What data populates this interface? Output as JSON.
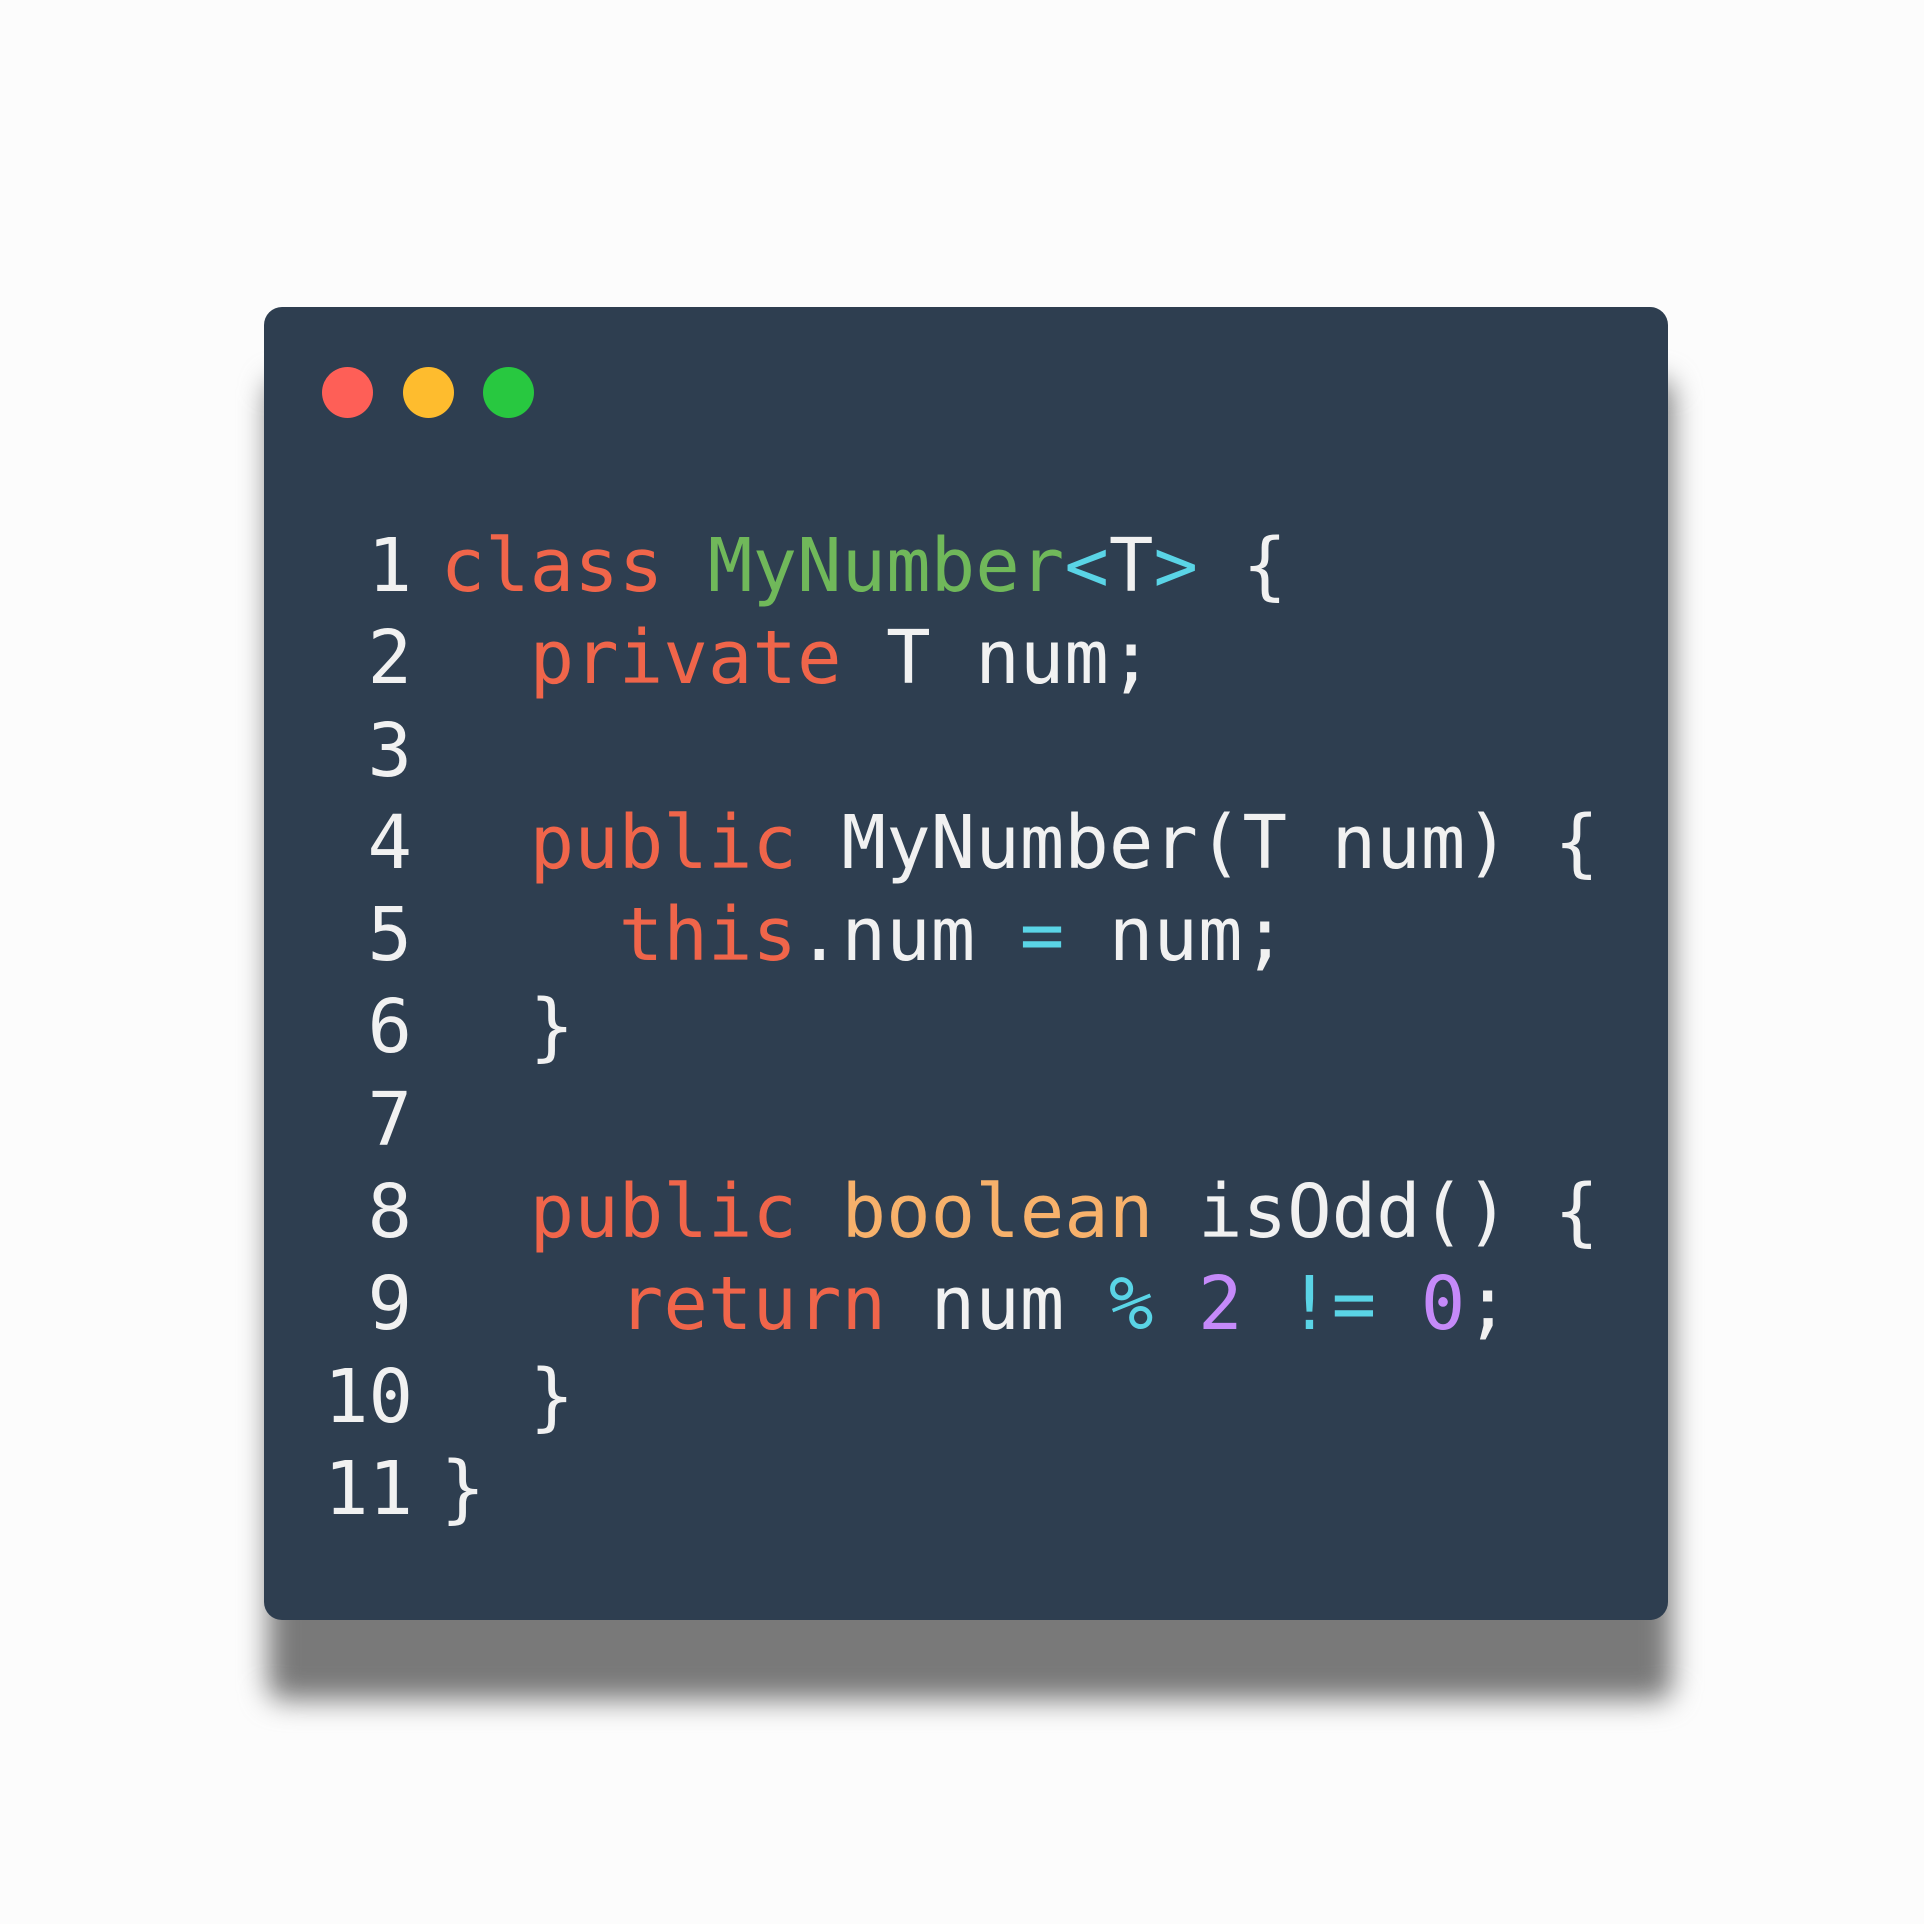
{
  "window": {
    "controls": [
      {
        "name": "close",
        "color": "#fe5f57"
      },
      {
        "name": "minimize",
        "color": "#febc2e"
      },
      {
        "name": "maximize",
        "color": "#28c840"
      }
    ]
  },
  "colors": {
    "background": "#2e3e50",
    "plain": "#f1f1f1",
    "keyword": "#f0654a",
    "type_keyword": "#f7b16b",
    "class_name": "#70b85a",
    "operator": "#5ad4e6",
    "number": "#c58af9",
    "line_number": "#f1f1f1"
  },
  "code": {
    "lines": [
      {
        "number": "1",
        "tokens": [
          {
            "text": "class",
            "kind": "keyword"
          },
          {
            "text": " ",
            "kind": "plain"
          },
          {
            "text": "MyNumber",
            "kind": "class_name"
          },
          {
            "text": "<",
            "kind": "operator"
          },
          {
            "text": "T",
            "kind": "plain"
          },
          {
            "text": ">",
            "kind": "operator"
          },
          {
            "text": " {",
            "kind": "plain"
          }
        ]
      },
      {
        "number": "2",
        "tokens": [
          {
            "text": "  ",
            "kind": "plain"
          },
          {
            "text": "private",
            "kind": "keyword"
          },
          {
            "text": " T num;",
            "kind": "plain"
          }
        ]
      },
      {
        "number": "3",
        "tokens": []
      },
      {
        "number": "4",
        "tokens": [
          {
            "text": "  ",
            "kind": "plain"
          },
          {
            "text": "public",
            "kind": "keyword"
          },
          {
            "text": " MyNumber(T num) {",
            "kind": "plain"
          }
        ]
      },
      {
        "number": "5",
        "tokens": [
          {
            "text": "    ",
            "kind": "plain"
          },
          {
            "text": "this",
            "kind": "keyword"
          },
          {
            "text": ".num ",
            "kind": "plain"
          },
          {
            "text": "=",
            "kind": "operator"
          },
          {
            "text": " num;",
            "kind": "plain"
          }
        ]
      },
      {
        "number": "6",
        "tokens": [
          {
            "text": "  }",
            "kind": "plain"
          }
        ]
      },
      {
        "number": "7",
        "tokens": []
      },
      {
        "number": "8",
        "tokens": [
          {
            "text": "  ",
            "kind": "plain"
          },
          {
            "text": "public",
            "kind": "keyword"
          },
          {
            "text": " ",
            "kind": "plain"
          },
          {
            "text": "boolean",
            "kind": "type_keyword"
          },
          {
            "text": " isOdd() {",
            "kind": "plain"
          }
        ]
      },
      {
        "number": "9",
        "tokens": [
          {
            "text": "    ",
            "kind": "plain"
          },
          {
            "text": "return",
            "kind": "keyword"
          },
          {
            "text": " num ",
            "kind": "plain"
          },
          {
            "text": "%",
            "kind": "operator"
          },
          {
            "text": " ",
            "kind": "plain"
          },
          {
            "text": "2",
            "kind": "number"
          },
          {
            "text": " ",
            "kind": "plain"
          },
          {
            "text": "!=",
            "kind": "operator"
          },
          {
            "text": " ",
            "kind": "plain"
          },
          {
            "text": "0",
            "kind": "number"
          },
          {
            "text": ";",
            "kind": "plain"
          }
        ]
      },
      {
        "number": "10",
        "tokens": [
          {
            "text": "  }",
            "kind": "plain"
          }
        ]
      },
      {
        "number": "11",
        "tokens": [
          {
            "text": "}",
            "kind": "plain"
          }
        ]
      }
    ]
  }
}
